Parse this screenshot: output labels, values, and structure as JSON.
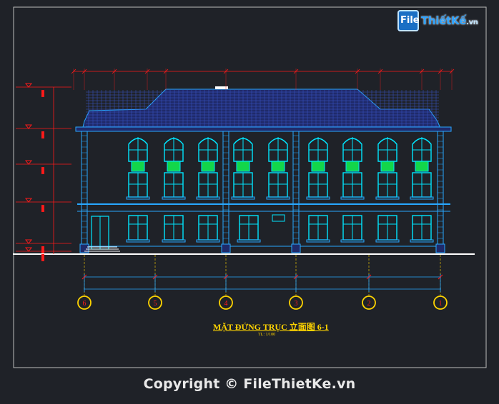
{
  "logo": {
    "mark": "File",
    "name": "ThiếtKế",
    "suffix": ".vn"
  },
  "drawing_title": "MẶT ĐỨNG TRỤC 立面图 6-1",
  "scale_label": "TL: 1/100",
  "copyright": "Copyright © FileThietKe.vn",
  "colors": {
    "background": "#1f2228",
    "outline": "#28a8ff",
    "window": "#00e6ff",
    "roof": "#1f2a6a",
    "dimension": "#ff1a1a",
    "axis": "#ffd400",
    "title": "#ffd400"
  },
  "grid_axes": [
    "6",
    "5",
    "4",
    "3",
    "2",
    "1"
  ]
}
